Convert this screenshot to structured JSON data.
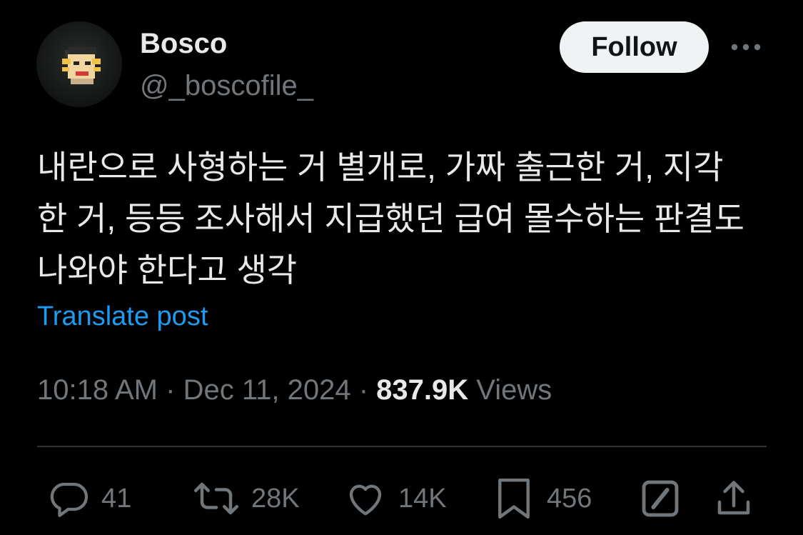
{
  "author": {
    "display_name": "Bosco",
    "handle": "@_boscofile_"
  },
  "follow_label": "Follow",
  "post": {
    "text": "내란으로 사형하는 거 별개로, 가짜 출근한 거, 지각\n한 거, 등등 조사해서 지급했던 급여 몰수하는 판결도\n나와야 한다고 생각",
    "translate_label": "Translate post"
  },
  "meta": {
    "time": "10:18 AM",
    "separator": "·",
    "date": "Dec 11, 2024",
    "views_count": "837.9K",
    "views_label": "Views"
  },
  "actions": {
    "replies": "41",
    "reposts": "28K",
    "likes": "14K",
    "bookmarks": "456"
  },
  "icons": {
    "more": "more-dots-icon",
    "reply": "reply-bubble-icon",
    "repost": "repost-arrows-icon",
    "like": "heart-icon",
    "bookmark": "bookmark-icon",
    "grok": "grok-slash-box-icon",
    "share": "share-upload-icon"
  },
  "colors": {
    "background": "#000000",
    "text_primary": "#e7e9ea",
    "text_secondary": "#71767b",
    "link": "#1d9bf0",
    "follow_bg": "#eff3f4",
    "divider": "#2f3336"
  }
}
